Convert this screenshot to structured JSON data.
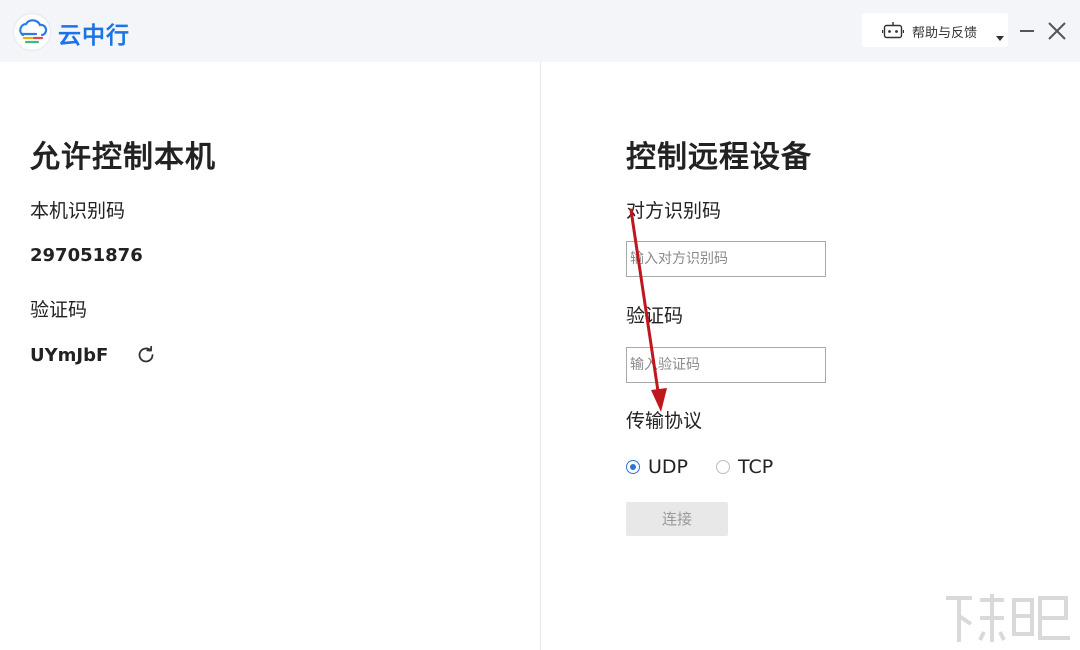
{
  "titlebar": {
    "app_title": "云中行",
    "help_label": "帮助与反馈",
    "icons": [
      "cloud-logo-icon",
      "robot-icon",
      "chevron-down-icon",
      "minimize-icon",
      "close-icon"
    ]
  },
  "left_panel": {
    "title": "允许控制本机",
    "id_label": "本机识别码",
    "id_value": "297051876",
    "code_label": "验证码",
    "code_value": "UYmJbF"
  },
  "right_panel": {
    "title": "控制远程设备",
    "peer_id_label": "对方识别码",
    "peer_id_placeholder": "输入对方识别码",
    "peer_id_value": "",
    "code_label": "验证码",
    "code_placeholder": "输入验证码",
    "code_value": "",
    "protocol_label": "传输协议",
    "protocols": [
      {
        "label": "UDP",
        "selected": true
      },
      {
        "label": "TCP",
        "selected": false
      }
    ],
    "connect_label": "连接"
  },
  "colors": {
    "accent": "#1b73e8",
    "radio_accent": "#2f74d0",
    "annotation_arrow": "#c0161d",
    "titlebar_bg": "#f4f5f9"
  }
}
